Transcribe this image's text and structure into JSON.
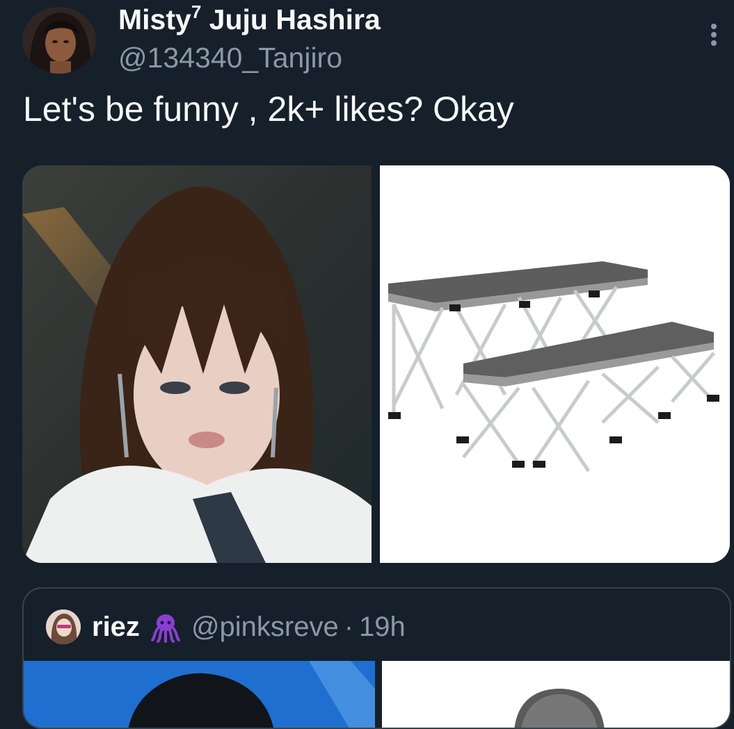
{
  "tweet": {
    "author": {
      "name": "Misty",
      "name_superscript": "7",
      "name_suffix": " Juju Hashira",
      "handle": "@134340_Tanjiro"
    },
    "text": "Let's be funny , 2k+ likes? Okay",
    "media": [
      {
        "type": "photo",
        "subject": "portrait-photo"
      },
      {
        "type": "photo",
        "subject": "stage-platforms-photo"
      }
    ]
  },
  "quoted_tweet": {
    "author": {
      "name": "riez",
      "emoji": "octopus-icon",
      "handle": "@pinksreve"
    },
    "separator": "·",
    "time": "19h",
    "media": [
      {
        "type": "photo",
        "subject": "person-photo"
      },
      {
        "type": "photo",
        "subject": "microphone-photo"
      }
    ]
  },
  "colors": {
    "background": "#15202b",
    "text_primary": "#f7f9f9",
    "text_secondary": "#8b98a5",
    "border": "#38444d",
    "emoji_purple": "#8a3fd1"
  }
}
